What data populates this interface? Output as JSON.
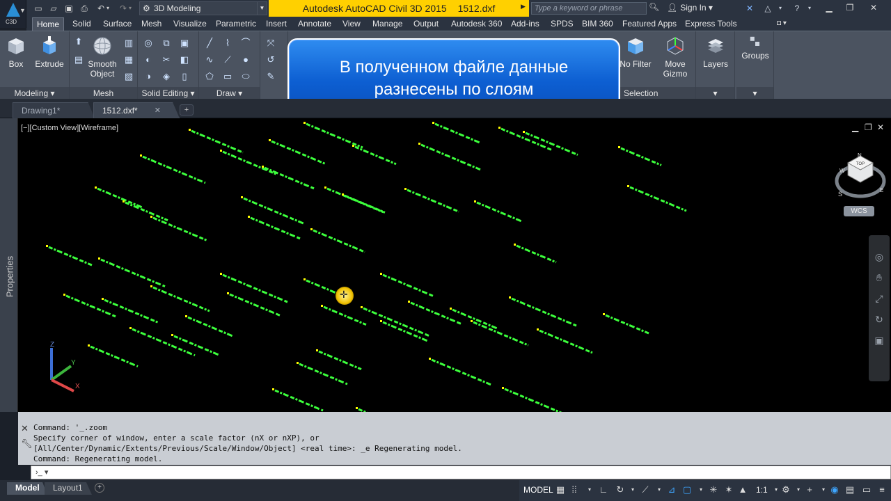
{
  "app": {
    "logo_label": "C3D",
    "workspace": "3D Modeling",
    "title_app": "Autodesk AutoCAD Civil 3D 2015",
    "title_file": "1512.dxf",
    "search_placeholder": "Type a keyword or phrase",
    "sign_in": "Sign In"
  },
  "ribbon_tabs": [
    "Home",
    "Solid",
    "Surface",
    "Mesh",
    "Visualize",
    "Parametric",
    "Insert",
    "Annotate",
    "View",
    "Manage",
    "Output",
    "Autodesk 360",
    "Add-ins",
    "SPDS",
    "BIM 360",
    "Featured Apps",
    "Express Tools"
  ],
  "ribbon": {
    "box": "Box",
    "extrude": "Extrude",
    "smooth_object_1": "Smooth",
    "smooth_object_2": "Object",
    "no_filter": "No Filter",
    "move_gizmo_1": "Move",
    "move_gizmo_2": "Gizmo",
    "layers": "Layers",
    "groups": "Groups",
    "panels": {
      "modeling": "Modeling ▾",
      "mesh": "Mesh",
      "solid_editing": "Solid Editing ▾",
      "draw": "Draw ▾",
      "selection": "Selection"
    }
  },
  "callout": {
    "line1": "В полученном файле данные",
    "line2": "разнесены по слоям"
  },
  "file_tabs": [
    "Drawing1*",
    "1512.dxf*"
  ],
  "viewport": {
    "label": "[−][Custom View][Wireframe]",
    "minimize": "▁",
    "restore": "❐",
    "close": "✕",
    "wcs": "WCS",
    "cube_top": "TOP",
    "compass_n": "N",
    "compass_s": "S",
    "compass_e": "E",
    "compass_w": "W"
  },
  "properties_label": "Properties",
  "command": {
    "history": [
      "Command: '_.zoom",
      "Specify corner of window, enter a scale factor (nX or nXP), or",
      "[All/Center/Dynamic/Extents/Previous/Scale/Window/Object] <real time>: _e Regenerating model.",
      "Command:  Regenerating model."
    ],
    "prompt": "›_ ▾"
  },
  "layout_tabs": [
    "Model",
    "Layout1"
  ],
  "status": {
    "model": "MODEL",
    "scale": "1:1"
  },
  "colors": {
    "point_text": "#3cff3c",
    "point_marker": "#ffff00",
    "title_bg": "#ffd000",
    "callout_bg": "#1a6fe0"
  }
}
